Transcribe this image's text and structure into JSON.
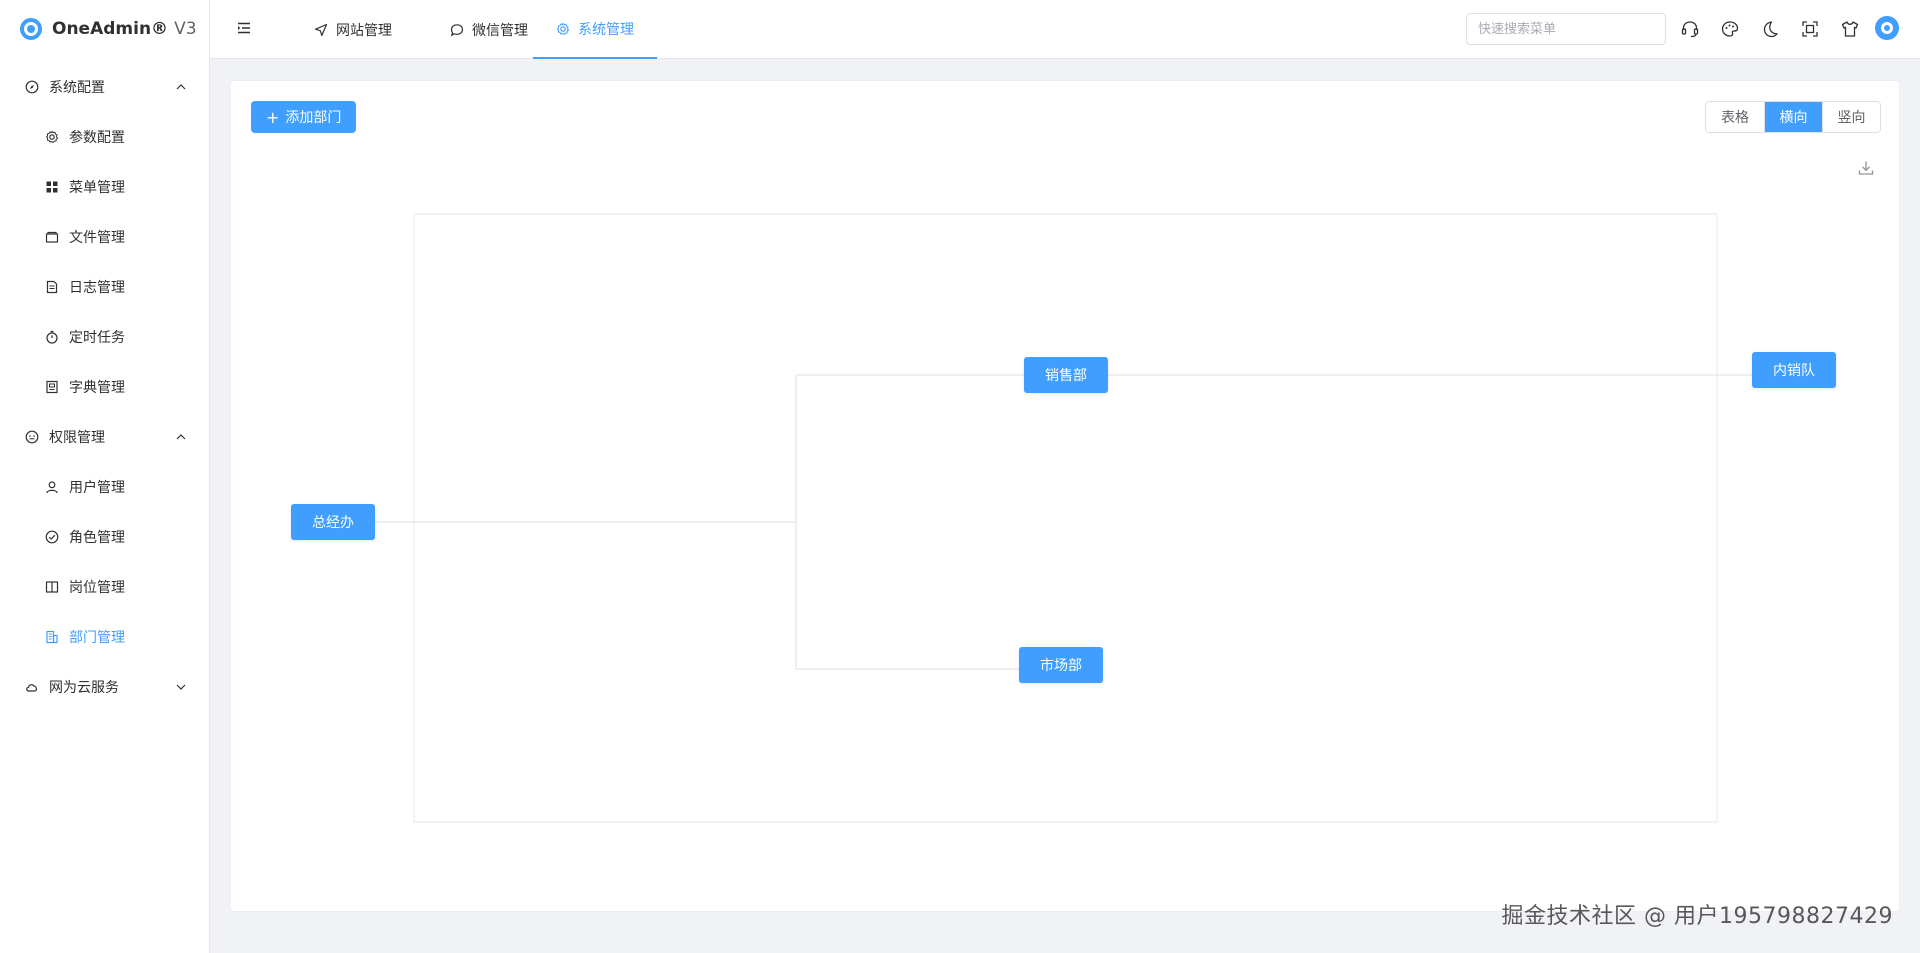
{
  "app": {
    "brand": "OneAdmin®",
    "version": "V3"
  },
  "sidebar": {
    "groups": [
      {
        "label": "系统配置",
        "items": [
          {
            "label": "参数配置",
            "icon": "gear-icon"
          },
          {
            "label": "菜单管理",
            "icon": "grid-icon"
          },
          {
            "label": "文件管理",
            "icon": "folder-icon"
          },
          {
            "label": "日志管理",
            "icon": "document-icon"
          },
          {
            "label": "定时任务",
            "icon": "stopwatch-icon"
          },
          {
            "label": "字典管理",
            "icon": "dictionary-icon"
          }
        ]
      },
      {
        "label": "权限管理",
        "items": [
          {
            "label": "用户管理",
            "icon": "user-icon"
          },
          {
            "label": "角色管理",
            "icon": "check-circle-icon"
          },
          {
            "label": "岗位管理",
            "icon": "book-icon"
          },
          {
            "label": "部门管理",
            "icon": "building-icon"
          }
        ]
      },
      {
        "label": "网为云服务",
        "items": []
      }
    ]
  },
  "header": {
    "tabs": [
      {
        "label": "网站管理",
        "icon": "navigation-icon"
      },
      {
        "label": "微信管理",
        "icon": "chat-icon"
      },
      {
        "label": "系统管理",
        "icon": "gear-icon"
      }
    ],
    "search_placeholder": "快速搜索菜单"
  },
  "main": {
    "add_button": "添加部门",
    "view_modes": [
      "表格",
      "横向",
      "竖向"
    ],
    "selected_view": "横向",
    "org": {
      "root": "总经办",
      "children": [
        {
          "name": "销售部",
          "children": [
            "内销队"
          ]
        },
        {
          "name": "市场部",
          "children": []
        }
      ]
    }
  },
  "watermark": "掘金技术社区 @ 用户195798827429"
}
